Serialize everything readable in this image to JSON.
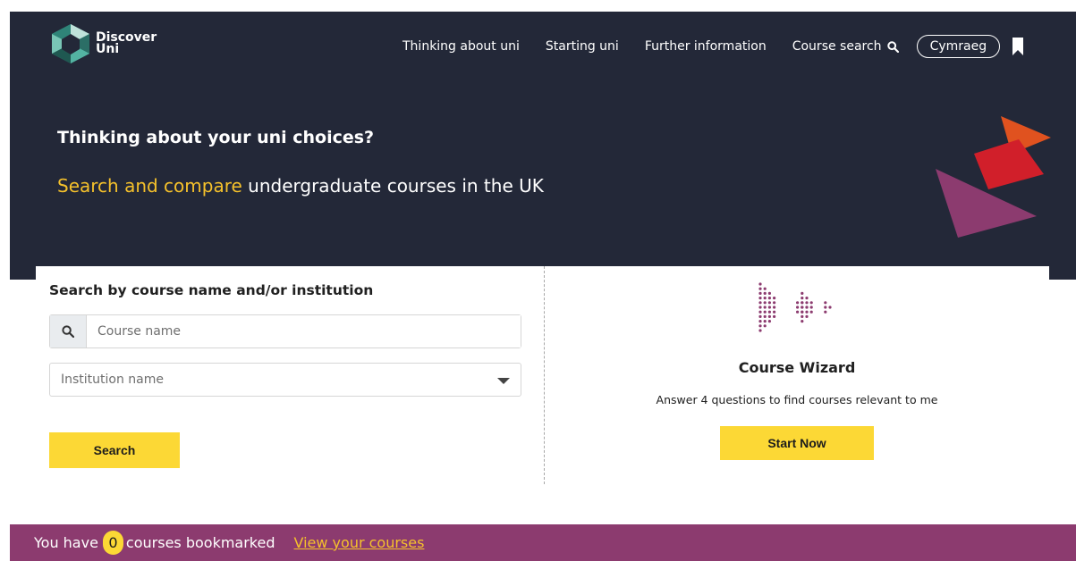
{
  "header": {
    "logo_text_line1": "Discover",
    "logo_text_line2": "Uni",
    "nav": [
      {
        "label": "Thinking about uni"
      },
      {
        "label": "Starting uni"
      },
      {
        "label": "Further information"
      },
      {
        "label": "Course search",
        "icon": "search-icon"
      }
    ],
    "language_button": "Cymraeg",
    "bookmark_icon": "bookmark-icon"
  },
  "hero": {
    "title": "Thinking about your uni choices?",
    "subtitle_highlight": "Search and compare",
    "subtitle_rest": " undergraduate courses in the UK"
  },
  "search": {
    "heading": "Search by course name and/or institution",
    "course_placeholder": "Course name",
    "institution_placeholder": "Institution name",
    "button_label": "Search"
  },
  "wizard": {
    "title": "Course Wizard",
    "description": "Answer 4 questions to find courses relevant to me",
    "button_label": "Start Now"
  },
  "bookmarks": {
    "prefix": "You have",
    "count": "0",
    "suffix": "courses bookmarked",
    "link_label": "View your courses"
  },
  "colors": {
    "hero_bg": "#232838",
    "accent_yellow": "#fcd835",
    "highlight_text": "#f5c12b",
    "bookmark_bar": "#8c3b6f",
    "wizard_dots": "#8c3b6f",
    "triangle_orange": "#e0521f",
    "triangle_red": "#d11f2a",
    "triangle_purple": "#8c3b6f"
  }
}
